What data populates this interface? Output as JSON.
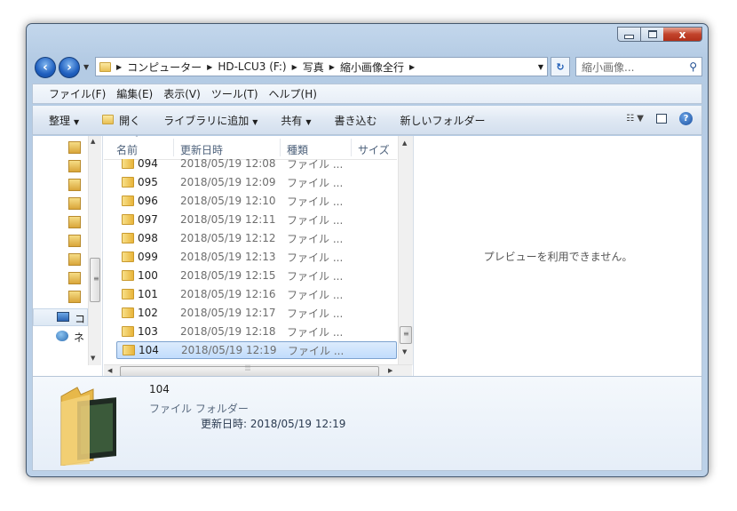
{
  "window": {
    "min_label": "",
    "max_label": "",
    "close_label": "x"
  },
  "address": {
    "crumbs": [
      "コンピューター",
      "HD-LCU3 (F:)",
      "写真",
      "縮小画像全行"
    ]
  },
  "search": {
    "placeholder": "縮小画像..."
  },
  "menu": [
    "ファイル(F)",
    "編集(E)",
    "表示(V)",
    "ツール(T)",
    "ヘルプ(H)"
  ],
  "toolbar": {
    "organize": "整理",
    "open": "開く",
    "add_library": "ライブラリに追加",
    "share": "共有",
    "burn": "書き込む",
    "new_folder": "新しいフォルダー"
  },
  "columns": {
    "name": "名前",
    "modified": "更新日時",
    "type": "種類",
    "size": "サイズ"
  },
  "files": [
    {
      "name": "094",
      "date": "2018/05/19 12:08",
      "type": "ファイル ..."
    },
    {
      "name": "095",
      "date": "2018/05/19 12:09",
      "type": "ファイル ..."
    },
    {
      "name": "096",
      "date": "2018/05/19 12:10",
      "type": "ファイル ..."
    },
    {
      "name": "097",
      "date": "2018/05/19 12:11",
      "type": "ファイル ..."
    },
    {
      "name": "098",
      "date": "2018/05/19 12:12",
      "type": "ファイル ..."
    },
    {
      "name": "099",
      "date": "2018/05/19 12:13",
      "type": "ファイル ..."
    },
    {
      "name": "100",
      "date": "2018/05/19 12:15",
      "type": "ファイル ..."
    },
    {
      "name": "101",
      "date": "2018/05/19 12:16",
      "type": "ファイル ..."
    },
    {
      "name": "102",
      "date": "2018/05/19 12:17",
      "type": "ファイル ..."
    },
    {
      "name": "103",
      "date": "2018/05/19 12:18",
      "type": "ファイル ..."
    },
    {
      "name": "104",
      "date": "2018/05/19 12:19",
      "type": "ファイル ..."
    }
  ],
  "nav_labels": {
    "computer": "コ",
    "network": "ネ"
  },
  "preview": {
    "message": "プレビューを利用できません。"
  },
  "details": {
    "name": "104",
    "type": "ファイル フォルダー",
    "modified": "更新日時: 2018/05/19 12:19"
  },
  "colors": {
    "selection": "#c1dcfc",
    "folder": "#e8b43a",
    "frame": "#b4cbe4"
  }
}
